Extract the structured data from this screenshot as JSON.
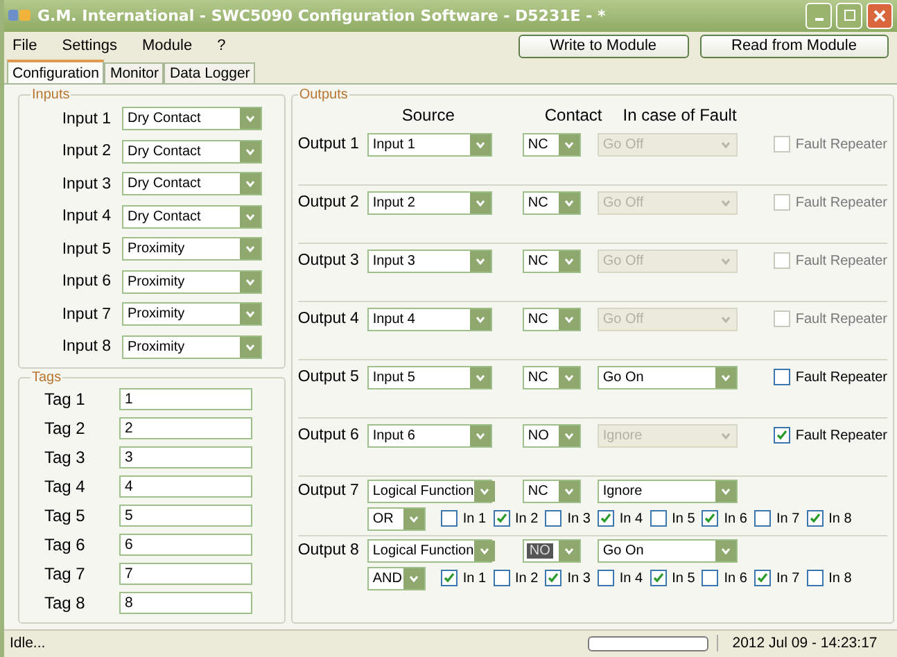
{
  "window": {
    "title": "G.M. International - SWC5090 Configuration Software - D5231E - *"
  },
  "menu": [
    "File",
    "Settings",
    "Module",
    "?"
  ],
  "toolbar_buttons": [
    "Write to Module",
    "Read from Module"
  ],
  "tabs": [
    {
      "label": "Configuration",
      "selected": true
    },
    {
      "label": "Monitor",
      "selected": false
    },
    {
      "label": "Data Logger",
      "selected": false
    }
  ],
  "inputs": {
    "title": "Inputs",
    "items": [
      {
        "label": "Input 1",
        "value": "Dry Contact"
      },
      {
        "label": "Input 2",
        "value": "Dry Contact"
      },
      {
        "label": "Input 3",
        "value": "Dry Contact"
      },
      {
        "label": "Input 4",
        "value": "Dry Contact"
      },
      {
        "label": "Input 5",
        "value": "Proximity"
      },
      {
        "label": "Input 6",
        "value": "Proximity"
      },
      {
        "label": "Input 7",
        "value": "Proximity"
      },
      {
        "label": "Input 8",
        "value": "Proximity"
      }
    ]
  },
  "tags": {
    "title": "Tags",
    "items": [
      {
        "label": "Tag 1",
        "value": "1"
      },
      {
        "label": "Tag 2",
        "value": "2"
      },
      {
        "label": "Tag 3",
        "value": "3"
      },
      {
        "label": "Tag 4",
        "value": "4"
      },
      {
        "label": "Tag 5",
        "value": "5"
      },
      {
        "label": "Tag 6",
        "value": "6"
      },
      {
        "label": "Tag 7",
        "value": "7"
      },
      {
        "label": "Tag 8",
        "value": "8"
      }
    ]
  },
  "outputs": {
    "title": "Outputs",
    "headers": [
      "Source",
      "Contact",
      "In case of Fault"
    ],
    "items": [
      {
        "label": "Output 1",
        "source": "Input 1",
        "contact": "NC",
        "contact_focused": false,
        "fault": "Go Off",
        "fault_disabled": true,
        "fault_repeater": {
          "label": "Fault Repeater",
          "checked": false,
          "disabled": true
        }
      },
      {
        "label": "Output 2",
        "source": "Input 2",
        "contact": "NC",
        "contact_focused": false,
        "fault": "Go Off",
        "fault_disabled": true,
        "fault_repeater": {
          "label": "Fault Repeater",
          "checked": false,
          "disabled": true
        }
      },
      {
        "label": "Output 3",
        "source": "Input 3",
        "contact": "NC",
        "contact_focused": false,
        "fault": "Go Off",
        "fault_disabled": true,
        "fault_repeater": {
          "label": "Fault Repeater",
          "checked": false,
          "disabled": true
        }
      },
      {
        "label": "Output 4",
        "source": "Input 4",
        "contact": "NC",
        "contact_focused": false,
        "fault": "Go Off",
        "fault_disabled": true,
        "fault_repeater": {
          "label": "Fault Repeater",
          "checked": false,
          "disabled": true
        }
      },
      {
        "label": "Output 5",
        "source": "Input 5",
        "contact": "NC",
        "contact_focused": false,
        "fault": "Go On",
        "fault_disabled": false,
        "fault_repeater": {
          "label": "Fault Repeater",
          "checked": false,
          "disabled": false
        }
      },
      {
        "label": "Output 6",
        "source": "Input 6",
        "contact": "NO",
        "contact_focused": false,
        "fault": "Ignore",
        "fault_disabled": true,
        "fault_repeater": {
          "label": "Fault Repeater",
          "checked": true,
          "disabled": false
        }
      },
      {
        "label": "Output 7",
        "source": "Logical Function",
        "contact": "NC",
        "contact_focused": false,
        "fault": "Ignore",
        "fault_disabled": false,
        "logic": {
          "operator": "OR",
          "inputs": [
            {
              "label": "In 1",
              "checked": false
            },
            {
              "label": "In 2",
              "checked": true
            },
            {
              "label": "In 3",
              "checked": false
            },
            {
              "label": "In 4",
              "checked": true
            },
            {
              "label": "In 5",
              "checked": false
            },
            {
              "label": "In 6",
              "checked": true
            },
            {
              "label": "In 7",
              "checked": false
            },
            {
              "label": "In 8",
              "checked": true
            }
          ]
        }
      },
      {
        "label": "Output 8",
        "source": "Logical Function",
        "contact": "NO",
        "contact_focused": true,
        "fault": "Go On",
        "fault_disabled": false,
        "logic": {
          "operator": "AND",
          "inputs": [
            {
              "label": "In 1",
              "checked": true
            },
            {
              "label": "In 2",
              "checked": false
            },
            {
              "label": "In 3",
              "checked": true
            },
            {
              "label": "In 4",
              "checked": false
            },
            {
              "label": "In 5",
              "checked": true
            },
            {
              "label": "In 6",
              "checked": false
            },
            {
              "label": "In 7",
              "checked": true
            },
            {
              "label": "In 8",
              "checked": false
            }
          ]
        }
      }
    ]
  },
  "status_bar": {
    "text": "Idle...",
    "progress": {
      "level": 0
    },
    "datetime": "2012 Jul 09 - 14:23:17"
  }
}
